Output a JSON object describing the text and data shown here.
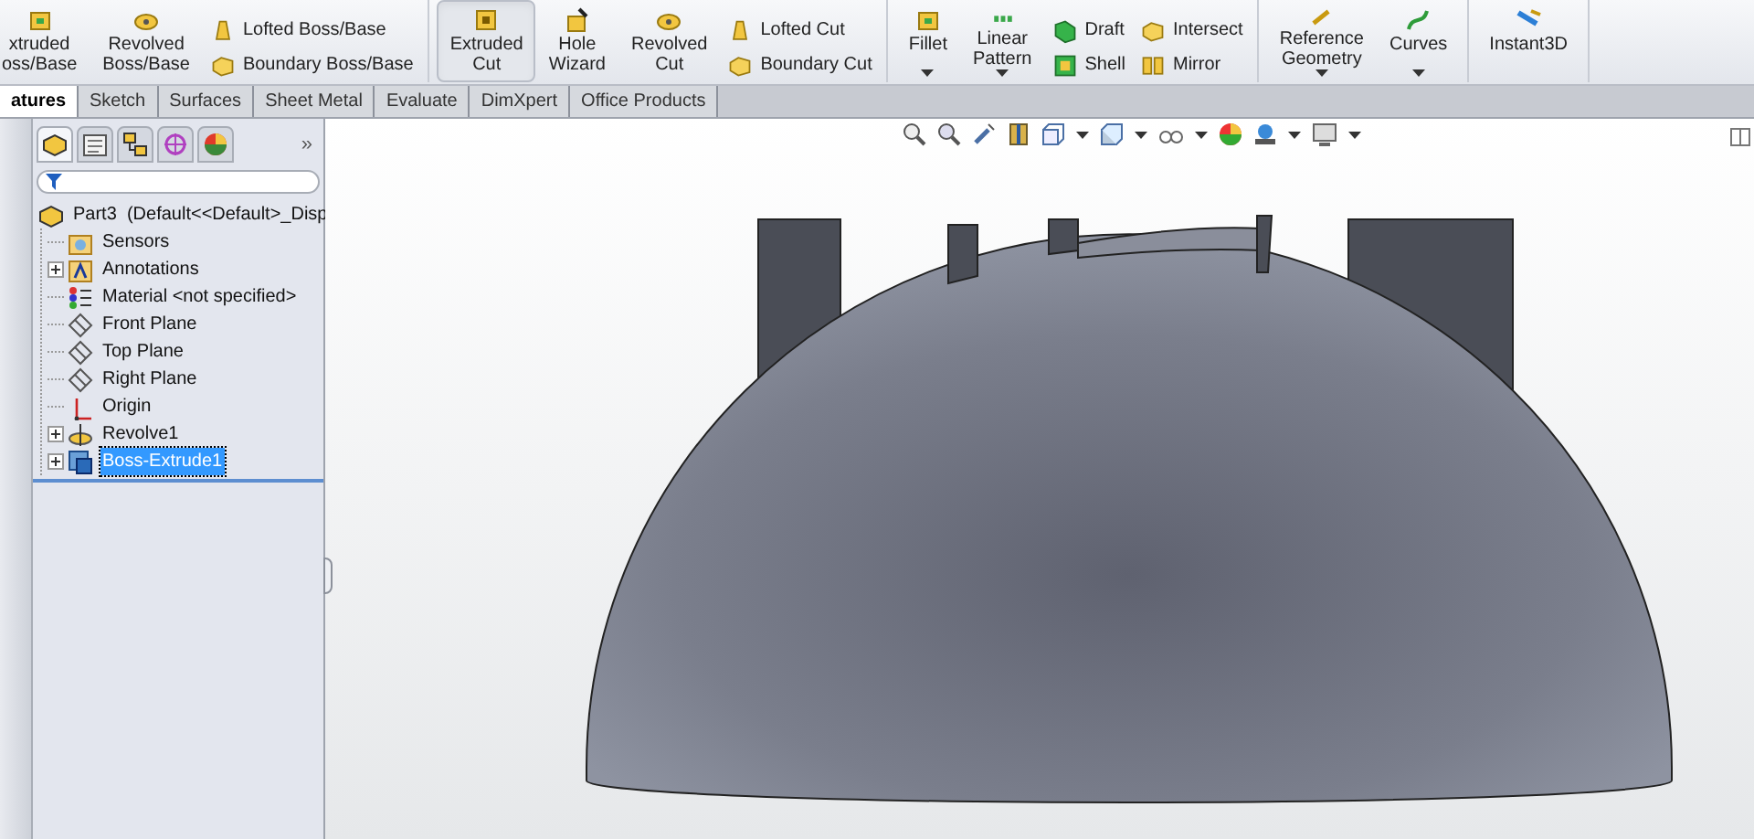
{
  "ribbon": {
    "groups": [
      {
        "items": [
          {
            "kind": "large",
            "label": "xtruded\noss/Base",
            "dropdown": false,
            "pressed": false
          },
          {
            "kind": "large",
            "label": "Revolved\nBoss/Base",
            "dropdown": false,
            "pressed": false
          },
          {
            "kind": "stack",
            "items": [
              {
                "label": "Lofted Boss/Base"
              },
              {
                "label": "Boundary Boss/Base"
              }
            ]
          }
        ]
      },
      {
        "items": [
          {
            "kind": "large",
            "label": "Extruded\nCut",
            "dropdown": false,
            "pressed": true
          },
          {
            "kind": "large",
            "label": "Hole\nWizard",
            "dropdown": false,
            "pressed": false
          },
          {
            "kind": "large",
            "label": "Revolved\nCut",
            "dropdown": false,
            "pressed": false
          },
          {
            "kind": "stack",
            "items": [
              {
                "label": "Lofted Cut"
              },
              {
                "label": "Boundary Cut"
              }
            ]
          }
        ]
      },
      {
        "items": [
          {
            "kind": "large",
            "label": "Fillet",
            "dropdown": true,
            "pressed": false
          },
          {
            "kind": "large",
            "label": "Linear\nPattern",
            "dropdown": true,
            "pressed": false
          },
          {
            "kind": "stack",
            "items": [
              {
                "label": "Draft"
              },
              {
                "label": "Shell"
              }
            ]
          },
          {
            "kind": "stack",
            "items": [
              {
                "label": "Intersect"
              },
              {
                "label": "Mirror"
              }
            ]
          }
        ]
      },
      {
        "items": [
          {
            "kind": "large",
            "label": "Reference\nGeometry",
            "dropdown": true,
            "pressed": false
          },
          {
            "kind": "large",
            "label": "Curves",
            "dropdown": true,
            "pressed": false
          }
        ]
      },
      {
        "items": [
          {
            "kind": "large",
            "label": "Instant3D",
            "dropdown": false,
            "pressed": false
          }
        ]
      }
    ]
  },
  "tabs": [
    {
      "label": "atures",
      "selected": true
    },
    {
      "label": "Sketch",
      "selected": false
    },
    {
      "label": "Surfaces",
      "selected": false
    },
    {
      "label": "Sheet Metal",
      "selected": false
    },
    {
      "label": "Evaluate",
      "selected": false
    },
    {
      "label": "DimXpert",
      "selected": false
    },
    {
      "label": "Office Products",
      "selected": false
    }
  ],
  "panel_tabs": [
    {
      "selected": true
    },
    {
      "selected": false
    },
    {
      "selected": false
    },
    {
      "selected": false
    },
    {
      "selected": false
    }
  ],
  "panel_more": "»",
  "tree": {
    "label": "Part3  (Default<<Default>_Disp",
    "children": [
      {
        "label": "Sensors",
        "collapsed": false,
        "selected": false
      },
      {
        "label": "Annotations",
        "collapsed": true,
        "selected": false
      },
      {
        "label": "Material <not specified>",
        "collapsed": false,
        "selected": false
      },
      {
        "label": "Front Plane",
        "collapsed": false,
        "selected": false
      },
      {
        "label": "Top Plane",
        "collapsed": false,
        "selected": false
      },
      {
        "label": "Right Plane",
        "collapsed": false,
        "selected": false
      },
      {
        "label": "Origin",
        "collapsed": false,
        "selected": false
      },
      {
        "label": "Revolve1",
        "collapsed": true,
        "selected": false
      },
      {
        "label": "Boss-Extrude1",
        "collapsed": true,
        "selected": true
      }
    ]
  }
}
